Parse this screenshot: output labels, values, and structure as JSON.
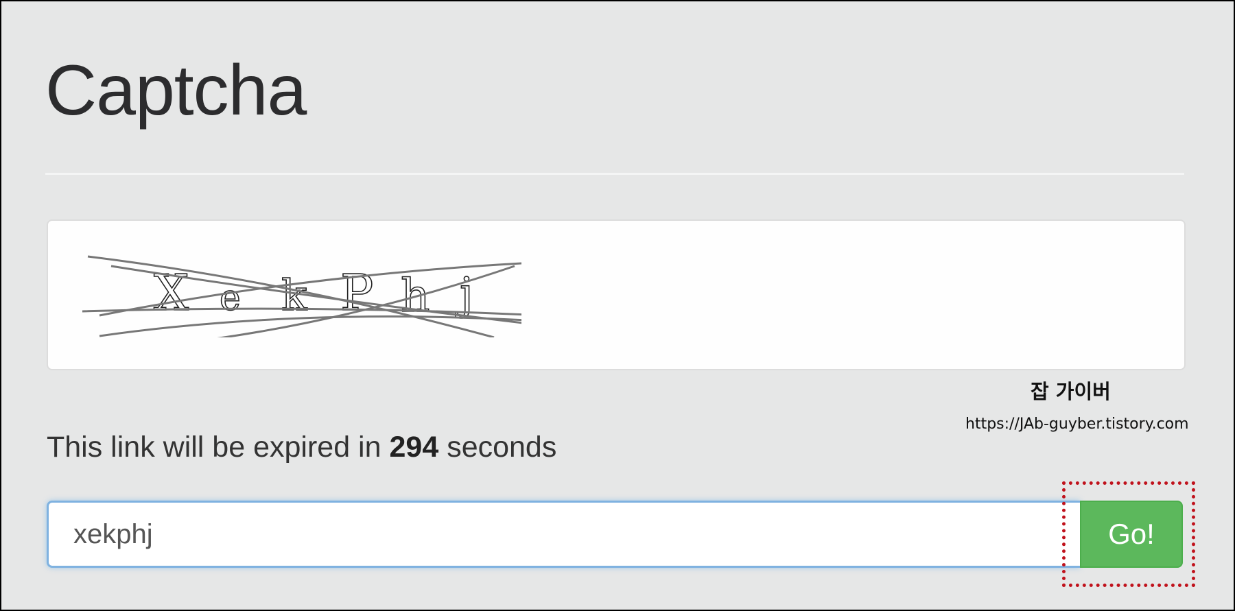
{
  "page": {
    "title": "Captcha"
  },
  "captcha": {
    "image_text": "XekPhj"
  },
  "watermark": {
    "title": "잡 가이버",
    "url": "https://JAb-guyber.tistory.com"
  },
  "expiry": {
    "prefix": "This link will be expired in",
    "seconds": "294",
    "suffix": "seconds"
  },
  "form": {
    "input_value": "xekphj",
    "button_label": "Go!"
  },
  "colors": {
    "background": "#e6e7e7",
    "button_green": "#5cb85c",
    "input_focus_border": "#7fb2e0",
    "highlight_red": "#c0121c"
  }
}
